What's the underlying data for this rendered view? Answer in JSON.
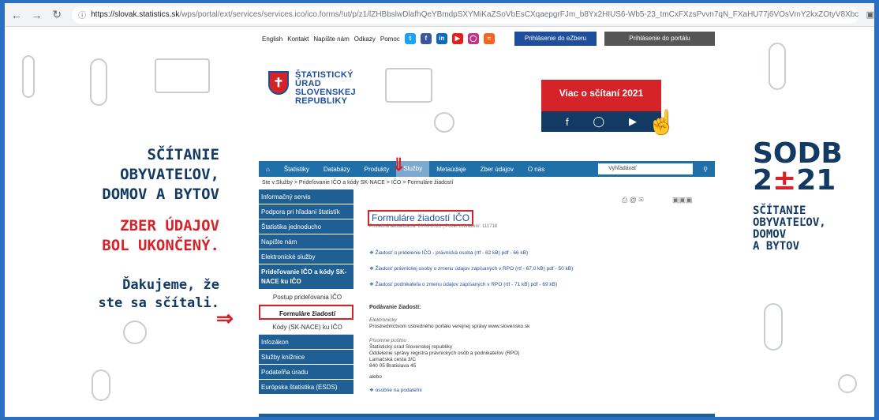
{
  "browser": {
    "url_host": "https://slovak.statistics.sk",
    "url_rest": "/wps/portal/ext/services/services.ico/ico.forms/!ut/p/z1/lZHBbslwDlafhQeYBmdpSXYMiKaZSoVbEsCXqaepgrFJm_b8Yx2HIUS6-Wb5-23_tmCxFXzsPvvn7qN_FXaHU77j6VOsVmY2kxZOtyV8XbchGIIMRWbASDtfw8TNwv...",
    "icon": "tab-icon"
  },
  "topbar": {
    "links": [
      "English",
      "Kontakt",
      "Napíšte nám",
      "Odkazy",
      "Pomoc"
    ],
    "login_ezber": "Prihlásenie do eZberu",
    "login_portal": "Prihlásenie do portálu"
  },
  "logo": {
    "line1": "ŠTATISTICKÝ",
    "line2": "ÚRAD",
    "line3": "SLOVENSKEJ",
    "line4": "REPUBLIKY"
  },
  "banner": {
    "title": "Viac o sčítaní 2021"
  },
  "left_promo": {
    "l1": "SČÍTANIE",
    "l2": "OBYVATEĽOV,",
    "l3": "DOMOV A BYTOV",
    "l4": "ZBER ÚDAJOV",
    "l5": "BOL UKONČENÝ.",
    "l6": "Ďakujeme, že",
    "l7": "ste sa sčítali."
  },
  "right_promo": {
    "l1": "SODB",
    "l2a": "2",
    "l2b": "±",
    "l2c": "21",
    "t1": "SČÍTANIE",
    "t2": "OBYVATEĽOV,",
    "t3": "DOMOV",
    "t4": "A BYTOV"
  },
  "menu": {
    "items": [
      "Štatistiky",
      "Databázy",
      "Produkty",
      "Služby",
      "Metaúdaje",
      "Zber údajov",
      "O nás"
    ],
    "search": "Vyhľadávať"
  },
  "breadcrumb": "Ste v:Služby > Prideľovanie IČO a kódy SK-NACE > IČO > Formuláre žiadostí",
  "sidemenu": [
    "Informačný servis",
    "Podpora pri hľadaní štatistík",
    "Štatistika jednoducho",
    "Napíšte nám",
    "Elektronické služby"
  ],
  "sidemenu_group": "Prideľovanie IČO a kódy SK-NACE ku IČO",
  "sidemenu_sub": [
    "Postup prideľovania IČO",
    "Formuláre žiadostí",
    "Kódy (SK-NACE) ku IČO"
  ],
  "sidemenu_rest": [
    "Infozákon",
    "Služby knižnice",
    "Podateľňa úradu",
    "Európska štatistika (ESDS)"
  ],
  "content": {
    "title": "Formuláre žiadostí IČO",
    "meta": "Posledná aktualizácia: 20.09.2021 | Počet zobrazení: 111718",
    "docs": [
      "Žiadosť o pridelenie IČO - právnická osoba (rtf - 62 kB)   pdf - 66 kB)",
      "Žiadosť právnickej osoby o zmenu údajov zapísaných v RPO (rtf - 67,0 kB)   pdf - 50 kB)",
      "Žiadosť podnikateľa o zmenu údajov zapísaných v RPO (rtf - 71 kB)   pdf - 69 kB)"
    ],
    "submit_h": "Podávanie žiadostí:",
    "elec_h": "Elektronicky",
    "elec_t": "Prostredníctvom ústredného portálu verejnej správy   www.slovensko.sk",
    "mail_h": "Písomne poštou :",
    "addr": [
      "Štatistický úrad Slovenskej republiky",
      "Oddelenie správy registra právnických osôb a podnikateľov (RPO)",
      "Lamačská cesta 3/C",
      "840 05 Bratislava 45"
    ],
    "or": "alebo",
    "inperson": "osobne na podateľni"
  }
}
